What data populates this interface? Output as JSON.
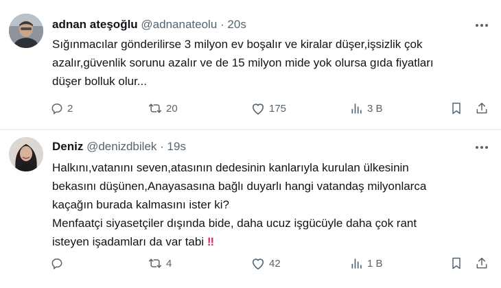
{
  "tweets": [
    {
      "name": "adnan ateşoğlu",
      "handle": "@adnanateolu",
      "separator": "·",
      "time": "20s",
      "text": "Sığınmacılar gönderilirse 3 milyon ev boşalır ve kiralar düşer,işsizlik çok\nazalır,güvenlik sorunu azalır ve de 15 milyon mide yok olursa gıda fiyatları\ndüşer bolluk olur...",
      "replies": "2",
      "retweets": "20",
      "likes": "175",
      "views": "3 B"
    },
    {
      "name": "Deniz",
      "handle": "@denizdbilek",
      "separator": "·",
      "time": "19s",
      "text": "Halkını,vatanını seven,atasının dedesinin kanlarıyla kurulan ülkesinin\nbekasını düşünen,Anayasasına bağlı duyarlı hangi vatandaş milyonlarca\nkaçağın burada kalmasını ister ki?\nMenfaatçi siyasetçiler dışında bide, daha ucuz işgücüyle daha çok rant\nisteyen işadamları da var tabi ",
      "emoji": "‼",
      "replies": "",
      "retweets": "4",
      "likes": "42",
      "views": "1 B"
    }
  ],
  "icons": {
    "more": "more-icon",
    "reply": "reply-icon",
    "retweet": "retweet-icon",
    "like": "like-icon",
    "views": "views-icon",
    "bookmark": "bookmark-icon",
    "share": "share-icon"
  },
  "colors": {
    "text": "#0f1419",
    "secondary": "#536471",
    "divider": "#eff3f4",
    "emoji": "#e0245e"
  }
}
